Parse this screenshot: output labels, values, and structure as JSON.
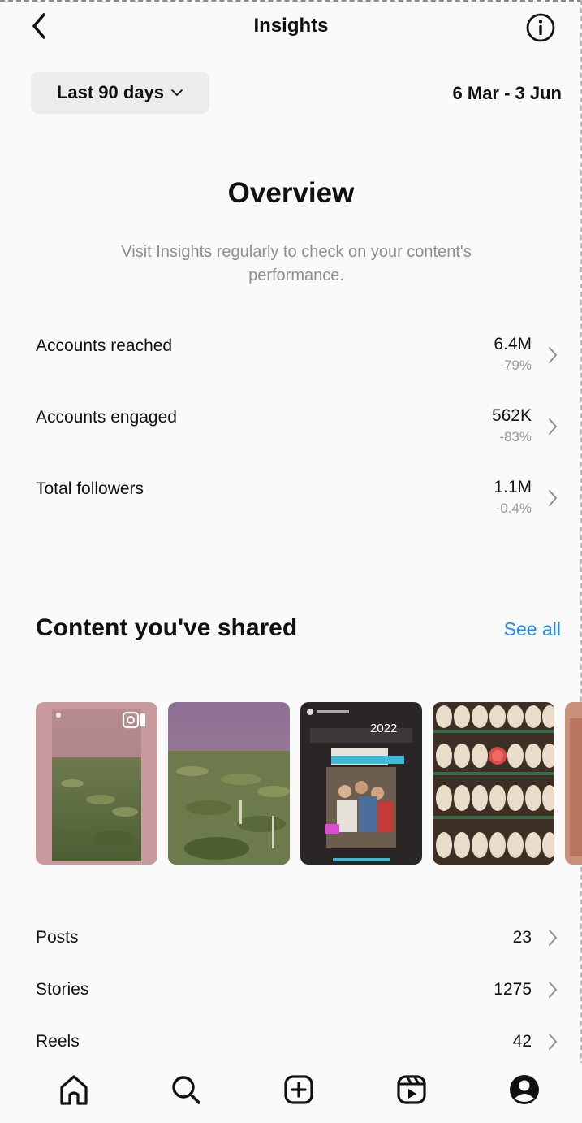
{
  "header": {
    "title": "Insights",
    "back_icon": "chevron-left-icon",
    "info_icon": "info-circle-icon"
  },
  "filter": {
    "range_label": "Last 90 days",
    "date_range": "6 Mar - 3 Jun"
  },
  "overview": {
    "title": "Overview",
    "subtitle": "Visit Insights regularly to check on your content's performance."
  },
  "metrics": [
    {
      "label": "Accounts reached",
      "value": "6.4M",
      "delta": "-79%"
    },
    {
      "label": "Accounts engaged",
      "value": "562K",
      "delta": "-83%"
    },
    {
      "label": "Total followers",
      "value": "1.1M",
      "delta": "-0.4%"
    }
  ],
  "content": {
    "title": "Content you've shared",
    "see_all": "See all",
    "accent_color": "#1d8cf8",
    "thumbnail_year_label": "2022"
  },
  "counts": [
    {
      "label": "Posts",
      "value": "23"
    },
    {
      "label": "Stories",
      "value": "1275"
    },
    {
      "label": "Reels",
      "value": "42"
    }
  ],
  "tabbar": {
    "icons": [
      "home-icon",
      "search-icon",
      "create-icon",
      "reels-icon",
      "profile-icon"
    ]
  }
}
